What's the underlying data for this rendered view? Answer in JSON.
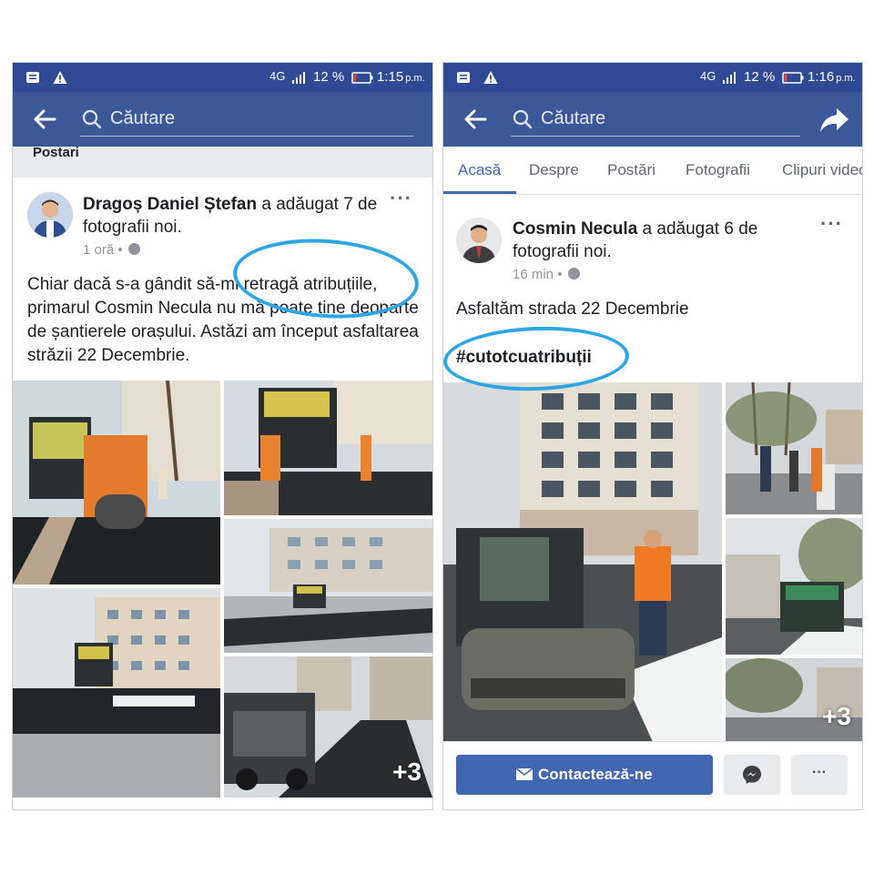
{
  "left": {
    "status": {
      "network": "4G",
      "battery": "12 %",
      "time": "1:15",
      "ampm": "p.m."
    },
    "search_placeholder": "Căutare",
    "section_label": "Postari",
    "post": {
      "author": "Dragoș Daniel Ștefan",
      "action": "a adăugat 7 de fotografii noi.",
      "time": "1 oră",
      "text": "Chiar dacă s-a gândit să-mi retragă atribuțiile, primarul Cosmin Necula nu mă poate ține deoparte de șantierele orașului. Astăzi am început asfaltarea străzii 22 Decembrie.",
      "more_photos": "+3"
    }
  },
  "right": {
    "status": {
      "network": "4G",
      "battery": "12 %",
      "time": "1:16",
      "ampm": "p.m."
    },
    "search_placeholder": "Căutare",
    "tabs": [
      "Acasă",
      "Despre",
      "Postări",
      "Fotografii",
      "Clipuri video"
    ],
    "active_tab": "Acasă",
    "post": {
      "author": "Cosmin Necula",
      "action": "a adăugat 6 de fotografii noi.",
      "time": "16 min",
      "text": "Asfaltăm strada 22 Decembrie",
      "hashtag": "#cutotcuatribuții",
      "more_photos": "+3"
    },
    "contact_label": "Contactează-ne",
    "more_label": "···"
  },
  "menu_dots": "···",
  "colors": {
    "header": "#3b5998",
    "status_bar": "#2f4a94",
    "accent": "#4267b2",
    "highlight": "#2ea6e6"
  },
  "icons": [
    "back-arrow-icon",
    "search-icon",
    "share-icon",
    "globe-icon",
    "messenger-icon",
    "mail-icon",
    "notification-icon",
    "warning-icon",
    "signal-icon",
    "battery-icon"
  ]
}
